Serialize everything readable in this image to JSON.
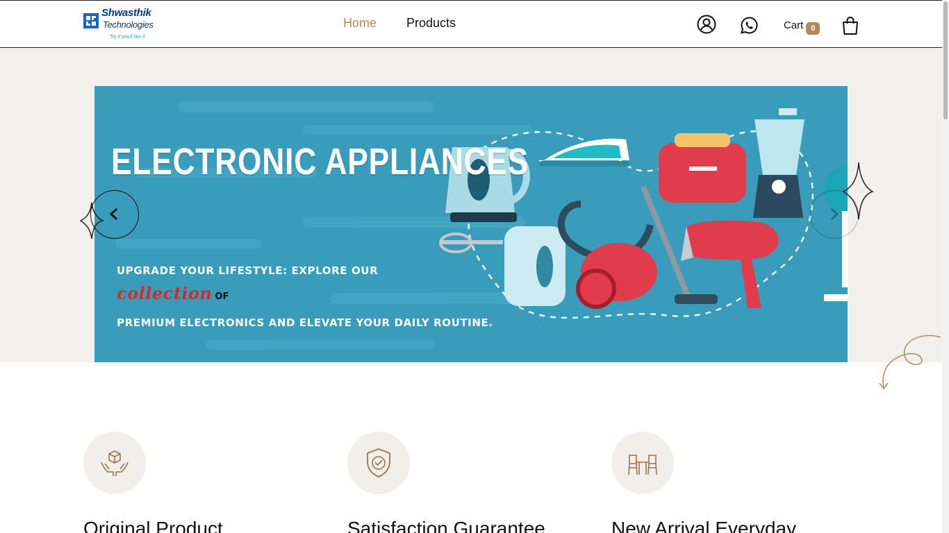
{
  "logo": {
    "line1": "Shwasthik",
    "line2": "Technologies",
    "tagline": "Try it you'll like it"
  },
  "nav": {
    "items": [
      {
        "label": "Home",
        "active": true
      },
      {
        "label": "Products",
        "active": false
      }
    ]
  },
  "header_icons": {
    "account": "user-circle-icon",
    "chat": "whatsapp-icon",
    "bag": "shopping-bag-icon"
  },
  "cart": {
    "label": "Cart",
    "count": "0"
  },
  "banner": {
    "title": "ELECTRONIC APPLIANCES",
    "line1": "UPGRADE YOUR LIFESTYLE: EXPLORE OUR",
    "highlight": "collection",
    "connector": "OF",
    "line3": "PREMIUM ELECTRONICS AND ELEVATE YOUR DAILY ROUTINE."
  },
  "carousel": {
    "prev_icon": "chevron-left-icon",
    "next_icon": "chevron-right-icon"
  },
  "features": [
    {
      "title": "Original Product",
      "icon": "hands-box-icon"
    },
    {
      "title": "Satisfaction Guarantee",
      "icon": "shield-check-icon"
    },
    {
      "title": "New Arrival Everyday",
      "icon": "furniture-icon"
    }
  ],
  "colors": {
    "accent": "#b08a5c",
    "banner_bg": "#3a9cbb",
    "hero_bg": "#f2f0ec",
    "highlight_red": "#d22b2b"
  }
}
